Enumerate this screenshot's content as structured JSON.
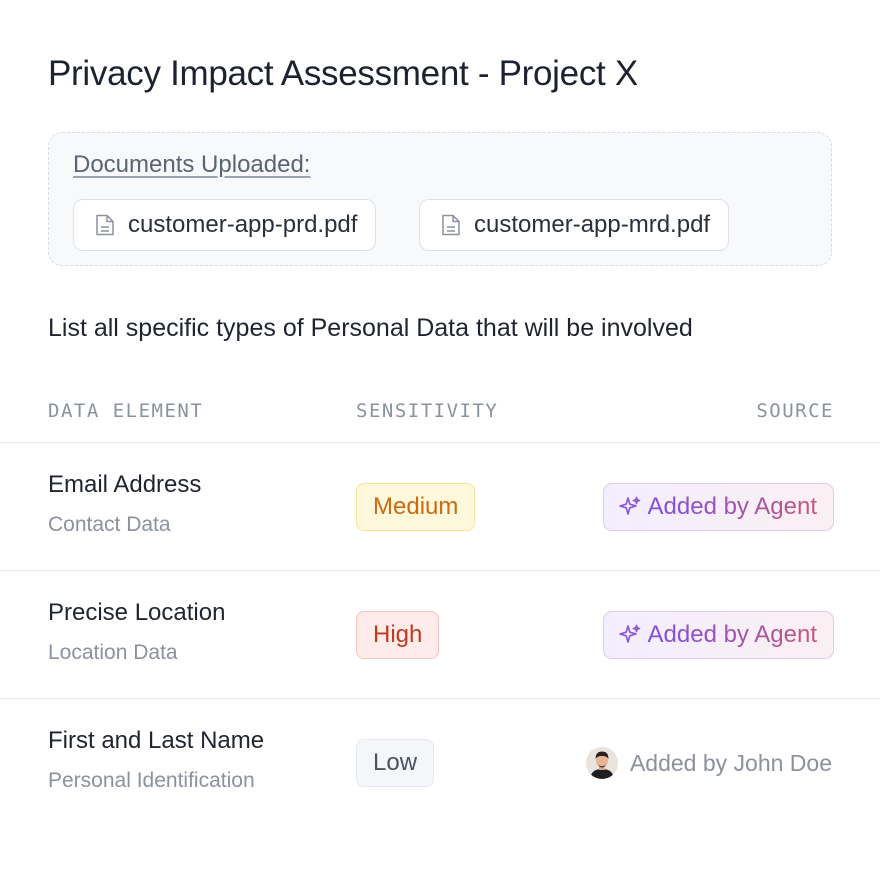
{
  "page": {
    "title": "Privacy Impact Assessment - Project X",
    "prompt": "List all specific types of Personal Data that will be involved"
  },
  "documents": {
    "label": "Documents Uploaded:",
    "files": [
      {
        "name": "customer-app-prd.pdf",
        "icon": "document-icon"
      },
      {
        "name": "customer-app-mrd.pdf",
        "icon": "document-icon"
      }
    ]
  },
  "table": {
    "headers": {
      "element": "DATA ELEMENT",
      "sensitivity": "SENSITIVITY",
      "source": "SOURCE"
    },
    "rows": [
      {
        "name": "Email Address",
        "category": "Contact Data",
        "sensitivity": "Medium",
        "source": "Added by Agent",
        "source_icon": "sparkle-icon"
      },
      {
        "name": "Precise Location",
        "category": "Location Data",
        "sensitivity": "High",
        "source": "Added by Agent",
        "source_icon": "sparkle-icon"
      },
      {
        "name": "First and Last Name",
        "category": "Personal Identification",
        "sensitivity": "Low",
        "source": "Added by John Doe",
        "source_icon": "avatar"
      }
    ]
  },
  "colors": {
    "medium": "#cc6a12",
    "high": "#c03a1e",
    "low": "#4a5261",
    "agent_gradient_start": "#7a4fe0",
    "agent_gradient_end": "#c4587e"
  }
}
